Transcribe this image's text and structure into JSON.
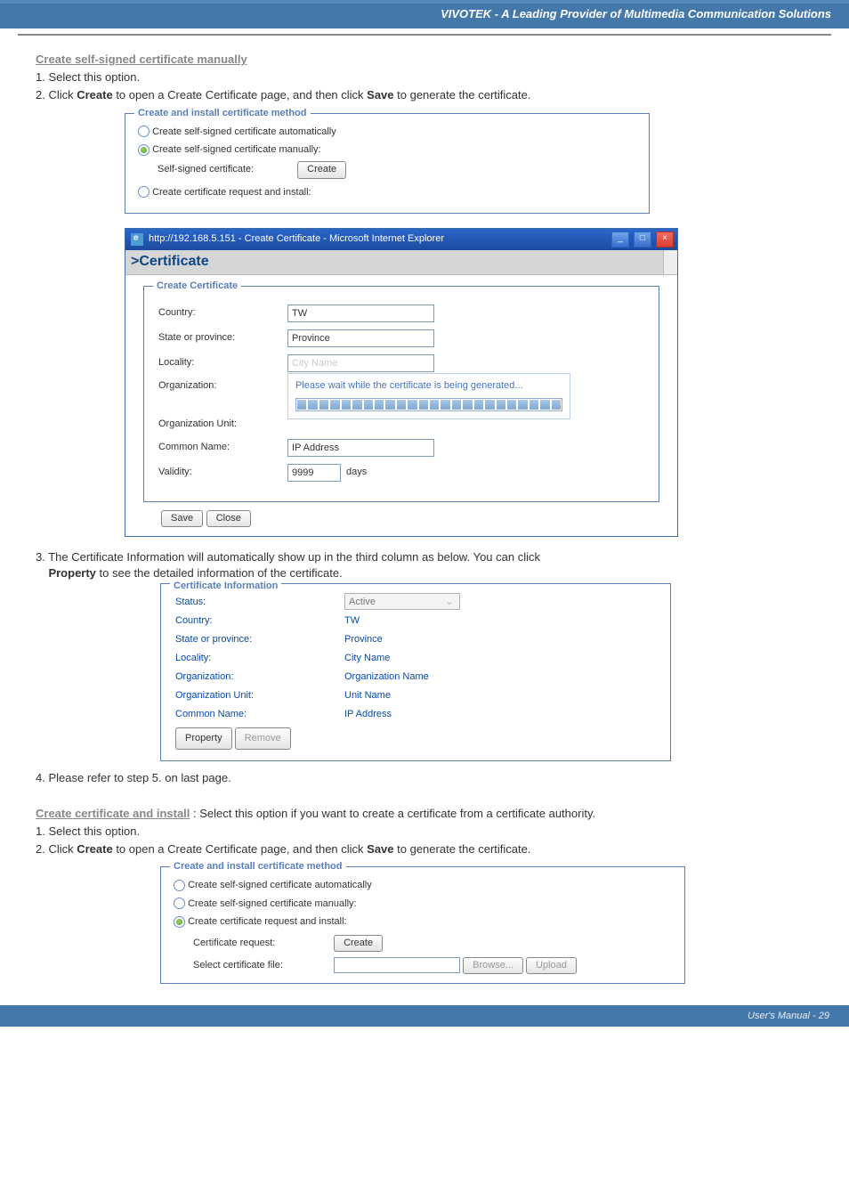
{
  "header": {
    "title": "VIVOTEK - A Leading Provider of Multimedia Communication Solutions"
  },
  "sec1": {
    "title": "Create self-signed certificate manually",
    "step1": "1. Select this option.",
    "step2_a": "2. Click ",
    "step2_b": "Create",
    "step2_c": " to open a Create Certificate page, and then click ",
    "step2_d": "Save",
    "step2_e": " to generate the certificate."
  },
  "fieldset1": {
    "legend": "Create and install certificate method",
    "opt1": "Create self-signed certificate automatically",
    "opt2": "Create self-signed certificate manually:",
    "self_label": "Self-signed certificate:",
    "create_btn": "Create",
    "opt3": "Create certificate request and install:"
  },
  "ie": {
    "title": "http://192.168.5.151 - Create Certificate - Microsoft Internet Explorer",
    "pagebar": ">Certificate",
    "legend": "Create Certificate",
    "rows": {
      "country_l": "Country:",
      "country_v": "TW",
      "state_l": "State or province:",
      "state_v": "Province",
      "locality_l": "Locality:",
      "locality_v": "City Name",
      "org_l": "Organization:",
      "orgunit_l": "Organization Unit:",
      "common_l": "Common Name:",
      "common_v": "IP Address",
      "validity_l": "Validity:",
      "validity_v": "9999",
      "days": "days"
    },
    "popup": "Please wait while the certificate is being generated...",
    "save": "Save",
    "close": "Close"
  },
  "sec3": {
    "body_a": "3. The Certificate Information will automatically show up in the third column as below. You can click ",
    "prop": "Property",
    "body_b": " to see the detailed information of the certificate."
  },
  "certinfo": {
    "legend": "Certificate Information",
    "status_l": "Status:",
    "status_v": "Active",
    "country_l": "Country:",
    "country_v": "TW",
    "state_l": "State or province:",
    "state_v": "Province",
    "locality_l": "Locality:",
    "locality_v": "City Name",
    "org_l": "Organization:",
    "org_v": "Organization Name",
    "orgunit_l": "Organization Unit:",
    "orgunit_v": "Unit Name",
    "common_l": "Common Name:",
    "common_v": "IP Address",
    "property_btn": "Property",
    "remove_btn": "Remove"
  },
  "sec4": {
    "text": "4. Please refer to step 5. on last page."
  },
  "sec5": {
    "title": "Create certificate and install",
    "desc": " :  Select this option if you want to create a certificate from a certificate authority.",
    "step1": "1. Select this option.",
    "step2_a": "2. Click ",
    "step2_b": "Create",
    "step2_c": " to open a Create Certificate page, and then click ",
    "step2_d": "Save",
    "step2_e": " to generate the certificate."
  },
  "fieldset2": {
    "legend": "Create and install certificate method",
    "opt1": "Create self-signed certificate automatically",
    "opt2": "Create self-signed certificate manually:",
    "opt3": "Create certificate request and install:",
    "req_l": "Certificate request:",
    "create_btn": "Create",
    "file_l": "Select certificate file:",
    "browse": "Browse...",
    "upload": "Upload"
  },
  "footer": {
    "text": "User's Manual - 29"
  }
}
